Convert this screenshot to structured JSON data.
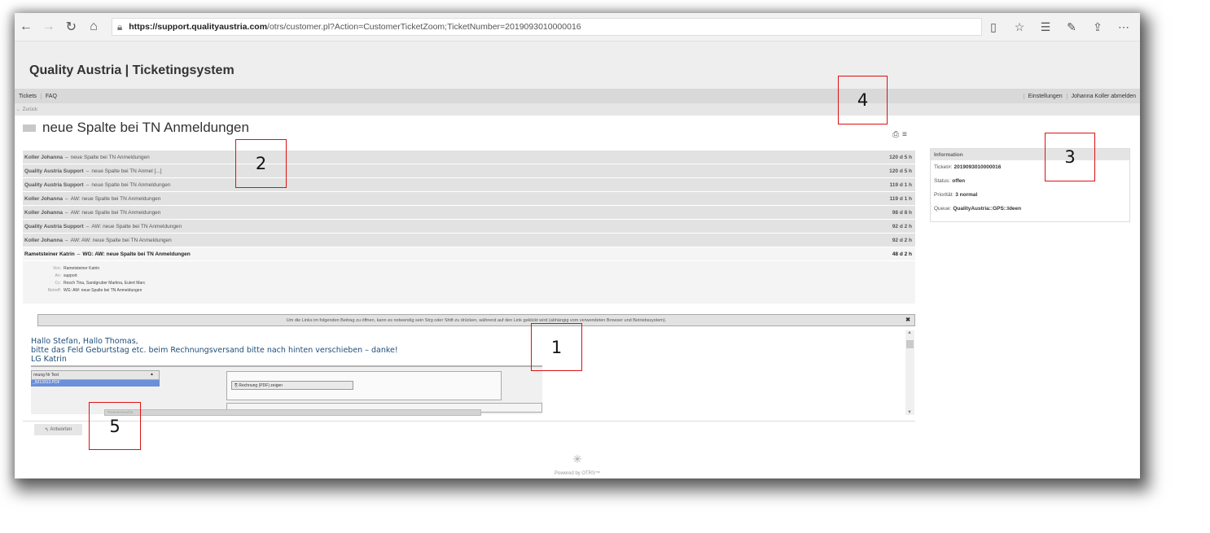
{
  "browser": {
    "url_host": "https://support.qualityaustria.com",
    "url_path": "/otrs/customer.pl?Action=CustomerTicketZoom;TicketNumber=2019093010000016",
    "back_icon": "arrow-left-icon",
    "forward_icon": "arrow-right-icon",
    "refresh_icon": "refresh-icon",
    "home_icon": "home-icon"
  },
  "app": {
    "title": "Quality Austria | Ticketingsystem"
  },
  "menu": {
    "left": [
      "Tickets",
      "FAQ"
    ],
    "right": [
      "Einstellungen",
      "Johanna Koller abmelden"
    ]
  },
  "back_link": "← Zurück",
  "ticket": {
    "title": "neue Spalte bei TN Anmeldungen"
  },
  "articles": [
    {
      "sender": "Koller Johanna",
      "subject": "neue Spalte bei TN Anmeldungen",
      "age": "120 d 5 h"
    },
    {
      "sender": "Quality Austria Support",
      "subject": "neue Spalte bei TN Anmel [...]",
      "age": "120 d 5 h"
    },
    {
      "sender": "Quality Austria Support",
      "subject": "neue Spalte bei TN Anmeldungen",
      "age": "119 d 1 h"
    },
    {
      "sender": "Koller Johanna",
      "subject": "AW: neue Spalte bei TN Anmeldungen",
      "age": "119 d 1 h"
    },
    {
      "sender": "Koller Johanna",
      "subject": "AW: neue Spalte bei TN Anmeldungen",
      "age": "98 d 8 h"
    },
    {
      "sender": "Quality Austria Support",
      "subject": "AW: neue Spalte bei TN Anmeldungen",
      "age": "92 d 2 h"
    },
    {
      "sender": "Koller Johanna",
      "subject": "AW: AW: neue Spalte bei TN Anmeldungen",
      "age": "92 d 2 h"
    },
    {
      "sender": "Rametsteiner Katrin",
      "subject": "WG: AW: neue Spalte bei TN Anmeldungen",
      "age": "48 d 2 h"
    }
  ],
  "meta": {
    "von_label": "Von:",
    "von": "Rametsteiner Katrin",
    "an_label": "An:",
    "an": "support",
    "cc_label": "Cc:",
    "cc": "Resch Tina, Sandgruber Martina, Eulert Marc",
    "betreff_label": "Betreff:",
    "betreff": "WG: AW: neue Spalte bei TN Anmeldungen"
  },
  "notice": "Um die Links im folgenden Beitrag zu öffnen, kann es notwendig sein Strg oder Shift zu drücken, während auf den Link geklickt wird (abhängig vom verwendeten Browser und Betriebssystem).",
  "message": {
    "line1": "Hallo Stefan, Hallo Thomas,",
    "line2": "bitte das Feld Geburtstag etc.  beim Rechnungsversand bitte nach hinten verschieben – danke!",
    "line3": "LG Katrin"
  },
  "embed": {
    "col_header": "nnung Nr Text",
    "selected": "_9213313.PDF",
    "button": "Rechnung (PDF) zeigen",
    "search": "Personensuche"
  },
  "reply_button": "Antworten",
  "info": {
    "head": "Information",
    "ticket_label": "Ticket#:",
    "ticket": "2019093010000016",
    "status_label": "Status:",
    "status": "offen",
    "prio_label": "Priorität:",
    "prio": "3 normal",
    "queue_label": "Queue:",
    "queue": "QualityAustria::GPS::Ideen"
  },
  "footer": {
    "powered": "Powered by OTRS™"
  },
  "annotations": [
    "1",
    "2",
    "3",
    "4",
    "5"
  ]
}
